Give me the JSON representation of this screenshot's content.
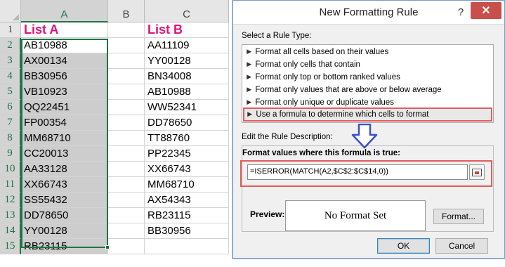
{
  "sheet": {
    "columns": [
      "A",
      "B",
      "C"
    ],
    "rows": [
      "1",
      "2",
      "3",
      "4",
      "5",
      "6",
      "7",
      "8",
      "9",
      "10",
      "11",
      "12",
      "13",
      "14",
      "15"
    ],
    "listA": {
      "header": "List A",
      "values": [
        "AB10988",
        "AX00134",
        "BB30956",
        "VB10923",
        "QQ22451",
        "FP00354",
        "MM68710",
        "CC20013",
        "AA33128",
        "XX66743",
        "SS55432",
        "DD78650",
        "YY00128",
        "RB23115"
      ]
    },
    "listB": {
      "header": "List B",
      "values": [
        "AA11109",
        "YY00128",
        "BN34008",
        "AB10988",
        "WW52341",
        "DD78650",
        "TT88760",
        "PP22345",
        "XX66743",
        "MM68710",
        "AX54343",
        "RB23115",
        "BB30956"
      ]
    }
  },
  "dialog": {
    "title": "New Formatting Rule",
    "help": "?",
    "close": "✕",
    "rule_type_label": "Select a Rule Type:",
    "rule_types": [
      "Format all cells based on their values",
      "Format only cells that contain",
      "Format only top or bottom ranked values",
      "Format only values that are above or below average",
      "Format only unique or duplicate values",
      "Use a formula to determine which cells to format"
    ],
    "selected_rule_index": 5,
    "description_label": "Edit the Rule Description:",
    "formula_label": "Format values where this formula is true:",
    "formula_value": "=ISERROR(MATCH(A2,$C$2:$C$14,0))",
    "preview_label": "Preview:",
    "preview_text": "No Format Set",
    "format_button": "Format...",
    "ok_button": "OK",
    "cancel_button": "Cancel"
  },
  "colors": {
    "header_text": "#e5117d",
    "highlight_border": "#e35b5b",
    "arrow": "#3a4fd1",
    "selection": "#217346"
  }
}
